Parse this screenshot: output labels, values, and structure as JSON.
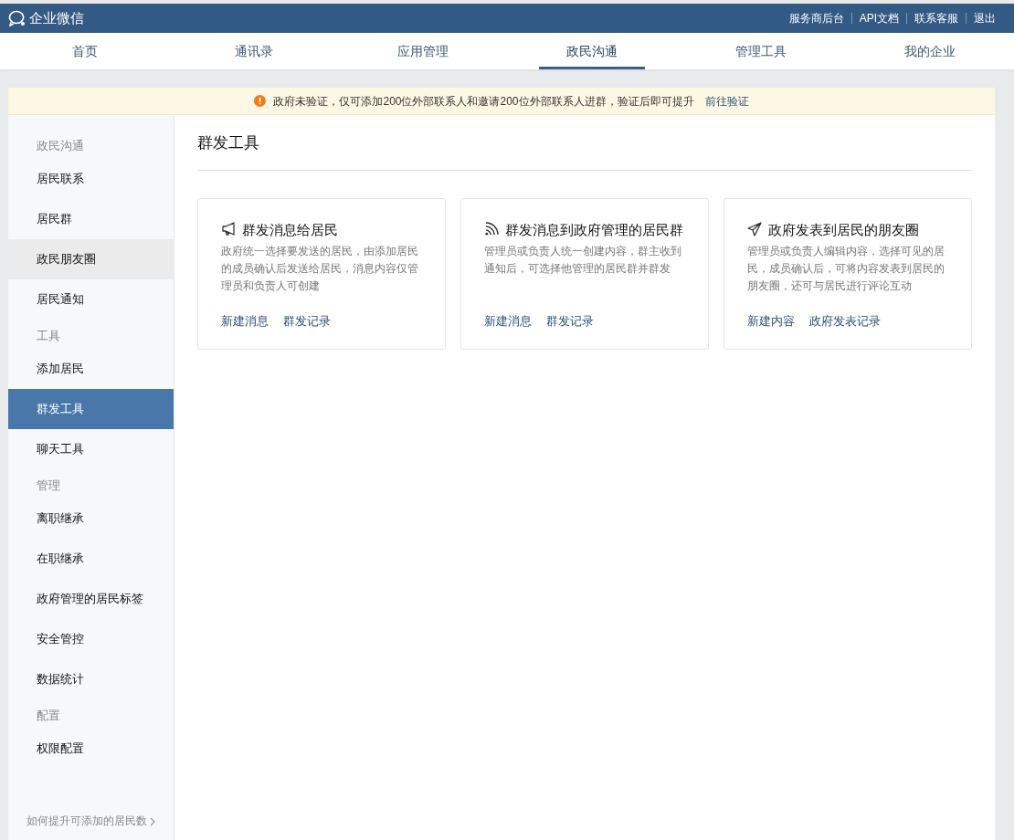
{
  "header": {
    "logo": "企业微信",
    "links": [
      "服务商后台",
      "API文档",
      "联系客服",
      "退出"
    ]
  },
  "tabs": [
    {
      "label": "首页",
      "selected": false
    },
    {
      "label": "通讯录",
      "selected": false
    },
    {
      "label": "应用管理",
      "selected": false
    },
    {
      "label": "政民沟通",
      "selected": true
    },
    {
      "label": "管理工具",
      "selected": false
    },
    {
      "label": "我的企业",
      "selected": false
    }
  ],
  "notice": {
    "text": "政府未验证，仅可添加200位外部联系人和邀请200位外部联系人进群，验证后即可提升",
    "link": "前往验证"
  },
  "sidebar": {
    "sections": [
      {
        "title": "政民沟通",
        "items": [
          {
            "label": "居民联系",
            "selected": false,
            "hovered": false
          },
          {
            "label": "居民群",
            "selected": false,
            "hovered": false
          },
          {
            "label": "政民朋友圈",
            "selected": false,
            "hovered": true
          },
          {
            "label": "居民通知",
            "selected": false,
            "hovered": false
          }
        ]
      },
      {
        "title": "工具",
        "items": [
          {
            "label": "添加居民",
            "selected": false,
            "hovered": false
          },
          {
            "label": "群发工具",
            "selected": true,
            "hovered": false
          },
          {
            "label": "聊天工具",
            "selected": false,
            "hovered": false
          }
        ]
      },
      {
        "title": "管理",
        "items": [
          {
            "label": "离职继承",
            "selected": false,
            "hovered": false
          },
          {
            "label": "在职继承",
            "selected": false,
            "hovered": false
          },
          {
            "label": "政府管理的居民标签",
            "selected": false,
            "hovered": false
          },
          {
            "label": "安全管控",
            "selected": false,
            "hovered": false
          },
          {
            "label": "数据统计",
            "selected": false,
            "hovered": false
          }
        ]
      },
      {
        "title": "配置",
        "items": [
          {
            "label": "权限配置",
            "selected": false,
            "hovered": false
          }
        ]
      }
    ],
    "footer_link": "如何提升可添加的居民数"
  },
  "page_title": "群发工具",
  "cards": [
    {
      "kind": "megaphone",
      "title": "群发消息给居民",
      "description": "政府统一选择要发送的居民，由添加居民的成员确认后发送给居民，消息内容仅管理员和负责人可创建",
      "links": [
        "新建消息",
        "群发记录"
      ]
    },
    {
      "kind": "broadcast",
      "title": "群发消息到政府管理的居民群",
      "description": "管理员或负责人统一创建内容，群主收到通知后，可选择他管理的居民群并群发",
      "links": [
        "新建消息",
        "群发记录"
      ]
    },
    {
      "kind": "send",
      "title": "政府发表到居民的朋友圈",
      "description": "管理员或负责人编辑内容，选择可见的居民，成员确认后，可将内容发表到居民的朋友圈，还可与居民进行评论互动",
      "links": [
        "新建内容",
        "政府发表记录"
      ]
    }
  ]
}
